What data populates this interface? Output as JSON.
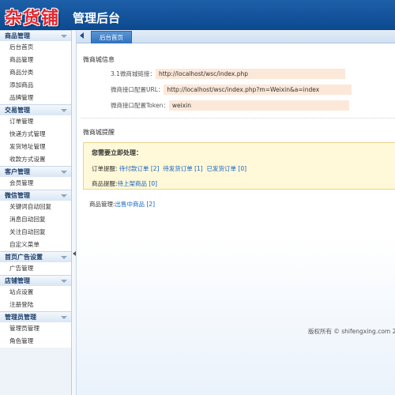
{
  "header": {
    "logo": "杂货铺",
    "title": "管理后台"
  },
  "sidebar": {
    "groups": [
      {
        "title": "商品管理",
        "items": [
          "后台首页",
          "商品管理",
          "商品分类",
          "添加商品",
          "品牌管理"
        ]
      },
      {
        "title": "交易管理",
        "items": [
          "订单管理",
          "快递方式管理",
          "发货地址管理",
          "收款方式设置"
        ]
      },
      {
        "title": "客户管理",
        "items": [
          "会员管理"
        ]
      },
      {
        "title": "微信管理",
        "items": [
          "关键词自动回复",
          "消息自动回复",
          "关注自动回复",
          "自定义菜单"
        ]
      },
      {
        "title": "首页广告设置",
        "items": [
          "广告管理"
        ]
      },
      {
        "title": "店铺管理",
        "items": [
          "站点设置",
          "注册登陆"
        ]
      },
      {
        "title": "管理员管理",
        "items": [
          "管理员管理",
          "角色管理"
        ]
      }
    ]
  },
  "tabs": {
    "active": "后台首页"
  },
  "info": {
    "title": "微商城信息",
    "rows": [
      {
        "label": "3.1微商城链接：",
        "value": "http://localhost/wsc/index.php"
      },
      {
        "label": "微商接口配置URL：",
        "value": "http://localhost/wsc/index.php?m=Weixin&a=index"
      },
      {
        "label": "微商接口配置Token：",
        "value": "weixin"
      }
    ]
  },
  "reminder": {
    "title": "微商城提醒",
    "alert_head": "您需要立即处理：",
    "order_label": "订单提醒:",
    "order_pending_pay": "待付款订单",
    "order_pending_pay_count": "[2]",
    "order_pending_ship": "待发货订单",
    "order_pending_ship_count": "[1]",
    "order_shipped": "已发货订单",
    "order_shipped_count": "[0]",
    "product_label": "商品提醒:",
    "product_pending": "待上架商品",
    "product_pending_count": "[0]",
    "mgmt_label": "商品管理:",
    "mgmt_selling": "出售中商品",
    "mgmt_selling_count": "[2]"
  },
  "footer": {
    "text": "版权所有 © shifengxing.com 2"
  },
  "colors": {
    "header": "#1d5fa8",
    "logo": "#e3262f",
    "link": "#1565c0",
    "alert_bg": "#fff8d9"
  }
}
